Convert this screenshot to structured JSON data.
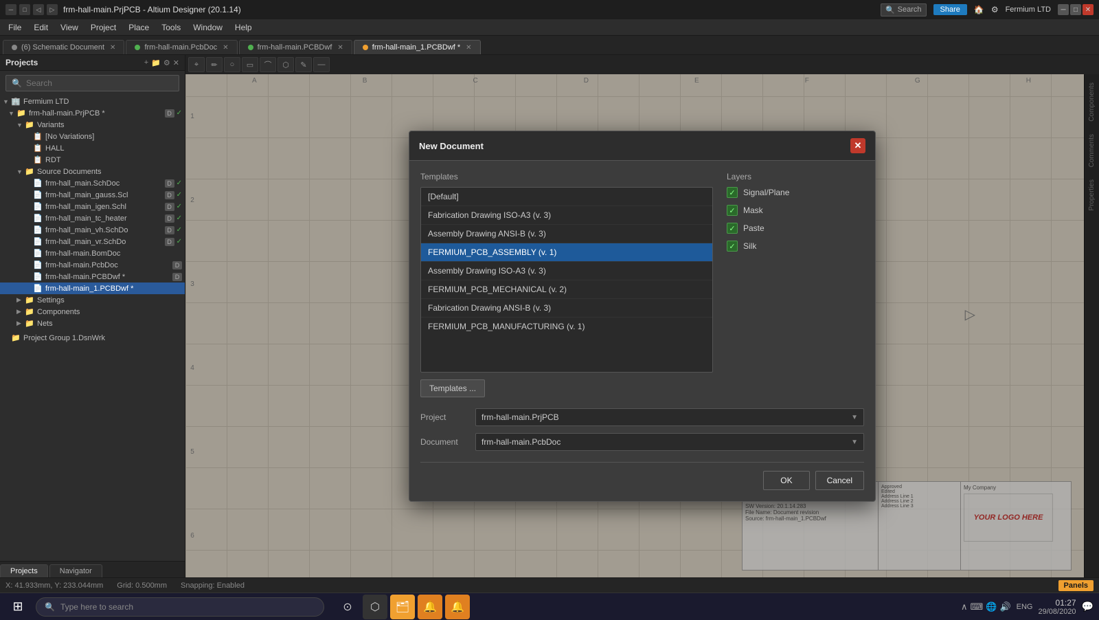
{
  "titlebar": {
    "title": "frm-hall-main.PrjPCB - Altium Designer (20.1.14)",
    "search_label": "Search",
    "share_label": "Share",
    "user_label": "Fermium LTD"
  },
  "menubar": {
    "items": [
      "File",
      "Edit",
      "View",
      "Project",
      "Place",
      "Tools",
      "Window",
      "Help"
    ]
  },
  "tabs": [
    {
      "label": "(6) Schematic Document",
      "active": false
    },
    {
      "label": "frm-hall-main.PcbDoc",
      "active": false
    },
    {
      "label": "frm-hall-main.PCBDwf",
      "active": false
    },
    {
      "label": "frm-hall-main_1.PCBDwf",
      "active": true
    }
  ],
  "left_panel": {
    "title": "Projects",
    "search_placeholder": "Search",
    "tree": [
      {
        "label": "Fermium LTD",
        "level": 0,
        "has_arrow": true,
        "icon": "🏢"
      },
      {
        "label": "frm-hall-main.PrjPCB *",
        "level": 1,
        "has_arrow": true,
        "icon": "📁",
        "badges": [
          "D",
          "✓"
        ]
      },
      {
        "label": "Variants",
        "level": 2,
        "has_arrow": true,
        "icon": "📁"
      },
      {
        "label": "[No Variations]",
        "level": 3,
        "has_arrow": false,
        "icon": "📋"
      },
      {
        "label": "HALL",
        "level": 3,
        "has_arrow": false,
        "icon": "📋"
      },
      {
        "label": "RDT",
        "level": 3,
        "has_arrow": false,
        "icon": "📋"
      },
      {
        "label": "Source Documents",
        "level": 2,
        "has_arrow": true,
        "icon": "📁"
      },
      {
        "label": "frm-hall_main.SchDoc",
        "level": 3,
        "has_arrow": false,
        "icon": "📄",
        "badges": [
          "D",
          "✓"
        ]
      },
      {
        "label": "frm-hall_main_gauss.Scl",
        "level": 3,
        "has_arrow": false,
        "icon": "📄",
        "badges": [
          "D",
          "✓"
        ]
      },
      {
        "label": "frm-hall_main_igen.Schl",
        "level": 3,
        "has_arrow": false,
        "icon": "📄",
        "badges": [
          "D",
          "✓"
        ]
      },
      {
        "label": "frm-hall_main_tc_heater",
        "level": 3,
        "has_arrow": false,
        "icon": "📄",
        "badges": [
          "D",
          "✓"
        ]
      },
      {
        "label": "frm-hall_main_vh.SchDo",
        "level": 3,
        "has_arrow": false,
        "icon": "📄",
        "badges": [
          "D",
          "✓"
        ]
      },
      {
        "label": "frm-hall_main_vr.SchDo",
        "level": 3,
        "has_arrow": false,
        "icon": "📄",
        "badges": [
          "D",
          "✓"
        ]
      },
      {
        "label": "frm-hall-main.BomDoc",
        "level": 3,
        "has_arrow": false,
        "icon": "📄"
      },
      {
        "label": "frm-hall-main.PcbDoc",
        "level": 3,
        "has_arrow": false,
        "icon": "📄",
        "badges": [
          "D"
        ]
      },
      {
        "label": "frm-hall-main.PCBDwf *",
        "level": 3,
        "has_arrow": false,
        "icon": "📄",
        "badges": [
          "D"
        ]
      },
      {
        "label": "frm-hall-main_1.PCBDwf *",
        "level": 3,
        "has_arrow": false,
        "icon": "📄",
        "selected": true
      },
      {
        "label": "Settings",
        "level": 2,
        "has_arrow": true,
        "icon": "📁"
      },
      {
        "label": "Components",
        "level": 2,
        "has_arrow": true,
        "icon": "📁"
      },
      {
        "label": "Nets",
        "level": 2,
        "has_arrow": true,
        "icon": "📁"
      },
      {
        "label": "Project Group 1.DsnWrk",
        "level": 0,
        "has_arrow": false,
        "icon": "📁"
      }
    ],
    "bottom_tabs": [
      "Projects",
      "Navigator"
    ]
  },
  "dialog": {
    "title": "New Document",
    "templates_label": "Templates",
    "layers_label": "Layers",
    "templates": [
      {
        "label": "[Default]",
        "selected": false
      },
      {
        "label": "Fabrication Drawing ISO-A3 (v. 3)",
        "selected": false
      },
      {
        "label": "Assembly Drawing ANSI-B (v. 3)",
        "selected": false
      },
      {
        "label": "FERMIUM_PCB_ASSEMBLY (v. 1)",
        "selected": true
      },
      {
        "label": "Assembly Drawing ISO-A3 (v. 3)",
        "selected": false
      },
      {
        "label": "FERMIUM_PCB_MECHANICAL (v. 2)",
        "selected": false
      },
      {
        "label": "Fabrication Drawing ANSI-B (v. 3)",
        "selected": false
      },
      {
        "label": "FERMIUM_PCB_MANUFACTURING (v. 1)",
        "selected": false
      }
    ],
    "layers": [
      {
        "label": "Signal/Plane",
        "checked": true
      },
      {
        "label": "Mask",
        "checked": true
      },
      {
        "label": "Paste",
        "checked": true
      },
      {
        "label": "Silk",
        "checked": true
      }
    ],
    "templates_btn_label": "Templates ...",
    "project_label": "Project",
    "project_value": "frm-hall-main.PrjPCB",
    "document_label": "Document",
    "document_value": "frm-hall-main.PcbDoc",
    "ok_label": "OK",
    "cancel_label": "Cancel"
  },
  "status_bar": {
    "coord": "X: 41.933mm, Y: 233.044mm",
    "grid": "Grid: 0.500mm",
    "snapping": "Snapping: Enabled",
    "panels_label": "Panels"
  },
  "pcb_toolbar": {
    "tools": [
      "⌖",
      "✏",
      "○",
      "▭",
      "⌒",
      "⬡",
      "✎",
      "—"
    ]
  },
  "side_panels": [
    "Components",
    "Comments",
    "Properties"
  ],
  "taskbar": {
    "search_placeholder": "Type here to search",
    "apps": [
      "🪟",
      "⬡",
      "📁",
      "🔔",
      "🔔"
    ],
    "time": "01:27",
    "date": "29/08/2020",
    "language": "ENG"
  },
  "row_labels": [
    "1",
    "2",
    "3",
    "4",
    "5",
    "6"
  ],
  "col_labels": [
    "A",
    "B",
    "C",
    "D",
    "E",
    "F",
    "G",
    "H"
  ]
}
